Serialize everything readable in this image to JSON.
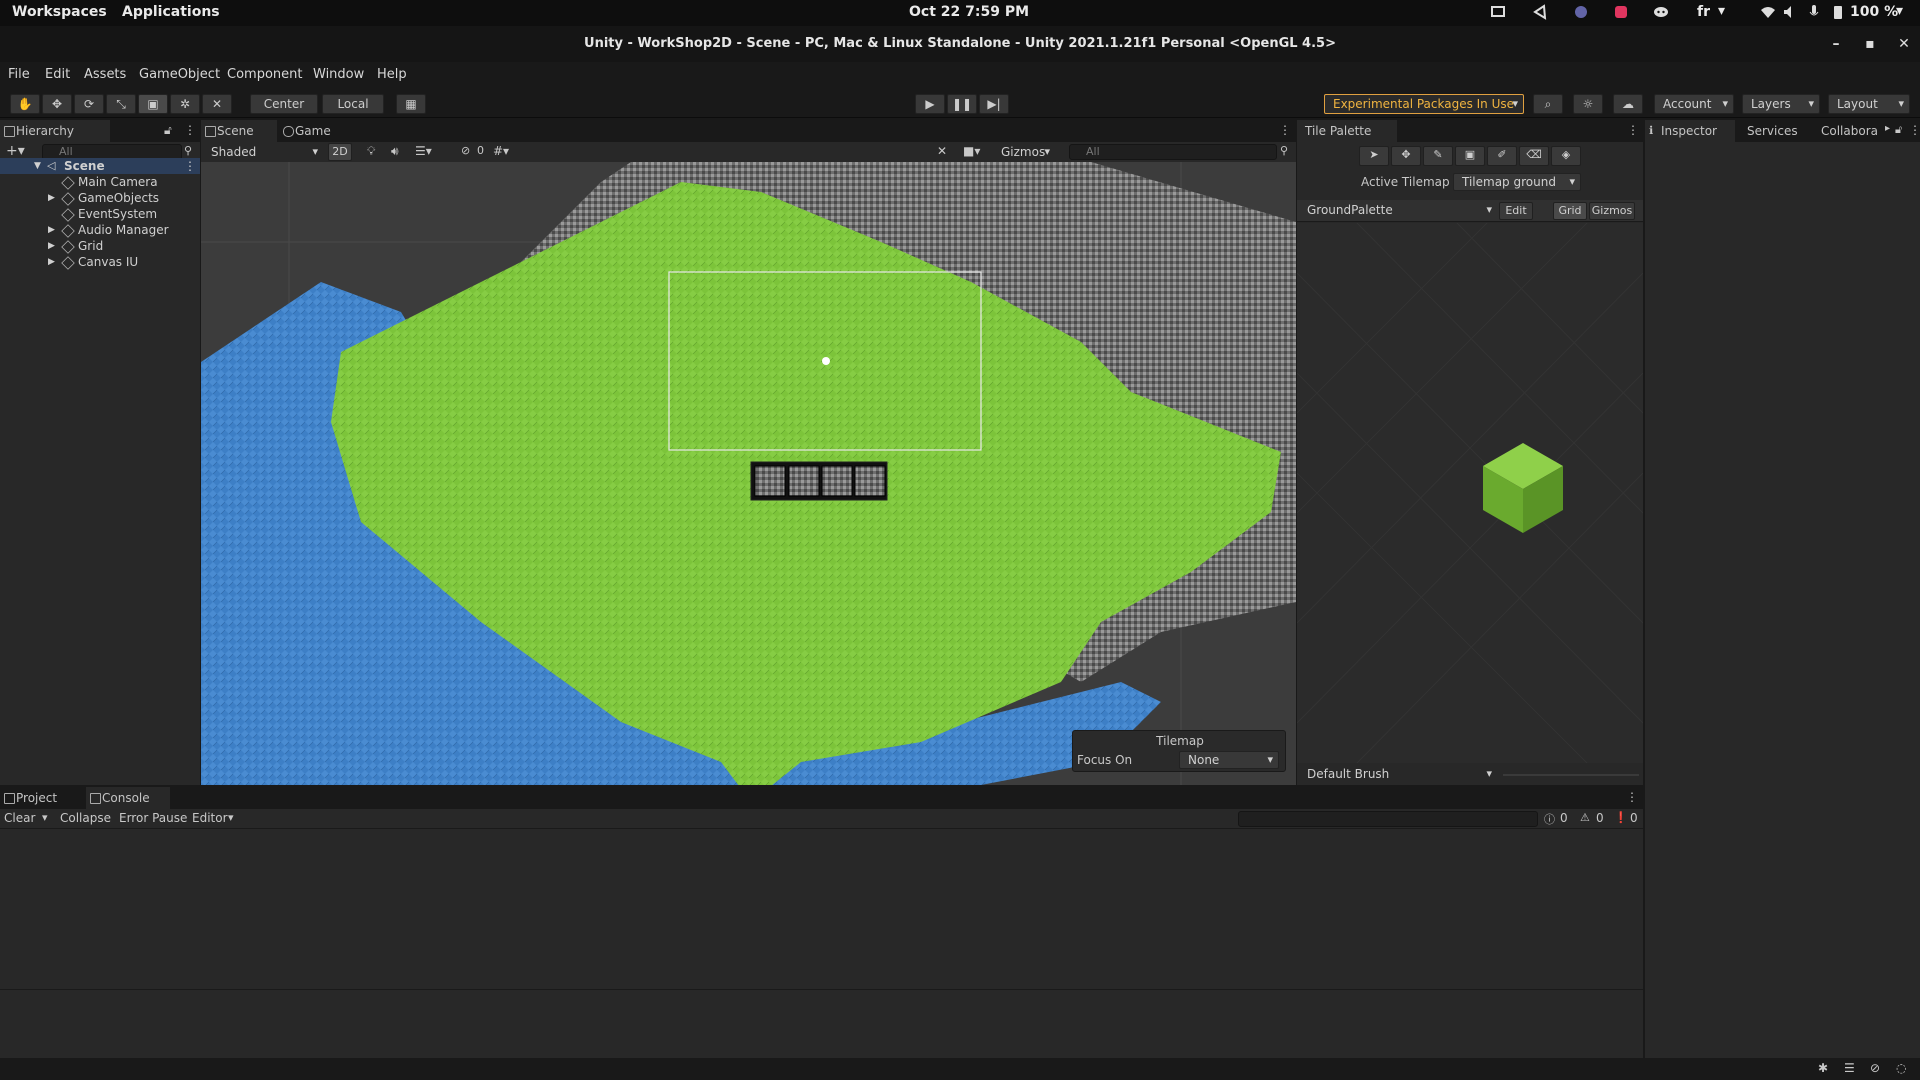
{
  "os_bar": {
    "workspaces": "Workspaces",
    "applications": "Applications",
    "clock": "Oct 22  7:59 PM",
    "lang": "fr",
    "battery": "100 %"
  },
  "window": {
    "title": "Unity - WorkShop2D - Scene - PC, Mac & Linux Standalone - Unity 2021.1.21f1 Personal <OpenGL 4.5>"
  },
  "menu": [
    "File",
    "Edit",
    "Assets",
    "GameObject",
    "Component",
    "Window",
    "Help"
  ],
  "toolbar": {
    "pivot_mode": "Center",
    "pivot_rotation": "Local",
    "experimental": "Experimental Packages In Use",
    "account": "Account",
    "layers": "Layers",
    "layout": "Layout",
    "colors": {
      "experimental_border": "#e0a040",
      "experimental_text": "#f0b440"
    }
  },
  "hierarchy": {
    "tab": "Hierarchy",
    "search_placeholder": "All",
    "scene": "Scene",
    "items": [
      {
        "label": "Main Camera",
        "expandable": false
      },
      {
        "label": "GameObjects",
        "expandable": true
      },
      {
        "label": "EventSystem",
        "expandable": false
      },
      {
        "label": "Audio Manager",
        "expandable": true
      },
      {
        "label": "Grid",
        "expandable": true
      },
      {
        "label": "Canvas IU",
        "expandable": true
      }
    ]
  },
  "scene_view": {
    "tabs": [
      "Scene",
      "Game"
    ],
    "shading": "Shaded",
    "mode_2d": "2D",
    "hidden_count": "0",
    "gizmos": "Gizmos",
    "search_placeholder": "All",
    "overlay": {
      "title": "Tilemap",
      "focus_label": "Focus On",
      "focus_value": "None"
    },
    "colors": {
      "grass": "#7cc43a",
      "water": "#3c7dc4",
      "rock": "#7a7a7a",
      "bg": "#3a3a3a"
    }
  },
  "tile_palette": {
    "tab": "Tile Palette",
    "active_tilemap_label": "Active Tilemap",
    "active_tilemap_value": "Tilemap ground",
    "palette": "GroundPalette",
    "edit": "Edit",
    "grid": "Grid",
    "gizmos": "Gizmos",
    "brush": "Default Brush"
  },
  "right_tabs": [
    "Inspector",
    "Services",
    "Collabora"
  ],
  "console": {
    "tabs": [
      "Project",
      "Console"
    ],
    "clear": "Clear",
    "collapse": "Collapse",
    "error_pause": "Error Pause",
    "editor": "Editor",
    "counts": [
      "0",
      "0",
      "0"
    ]
  }
}
